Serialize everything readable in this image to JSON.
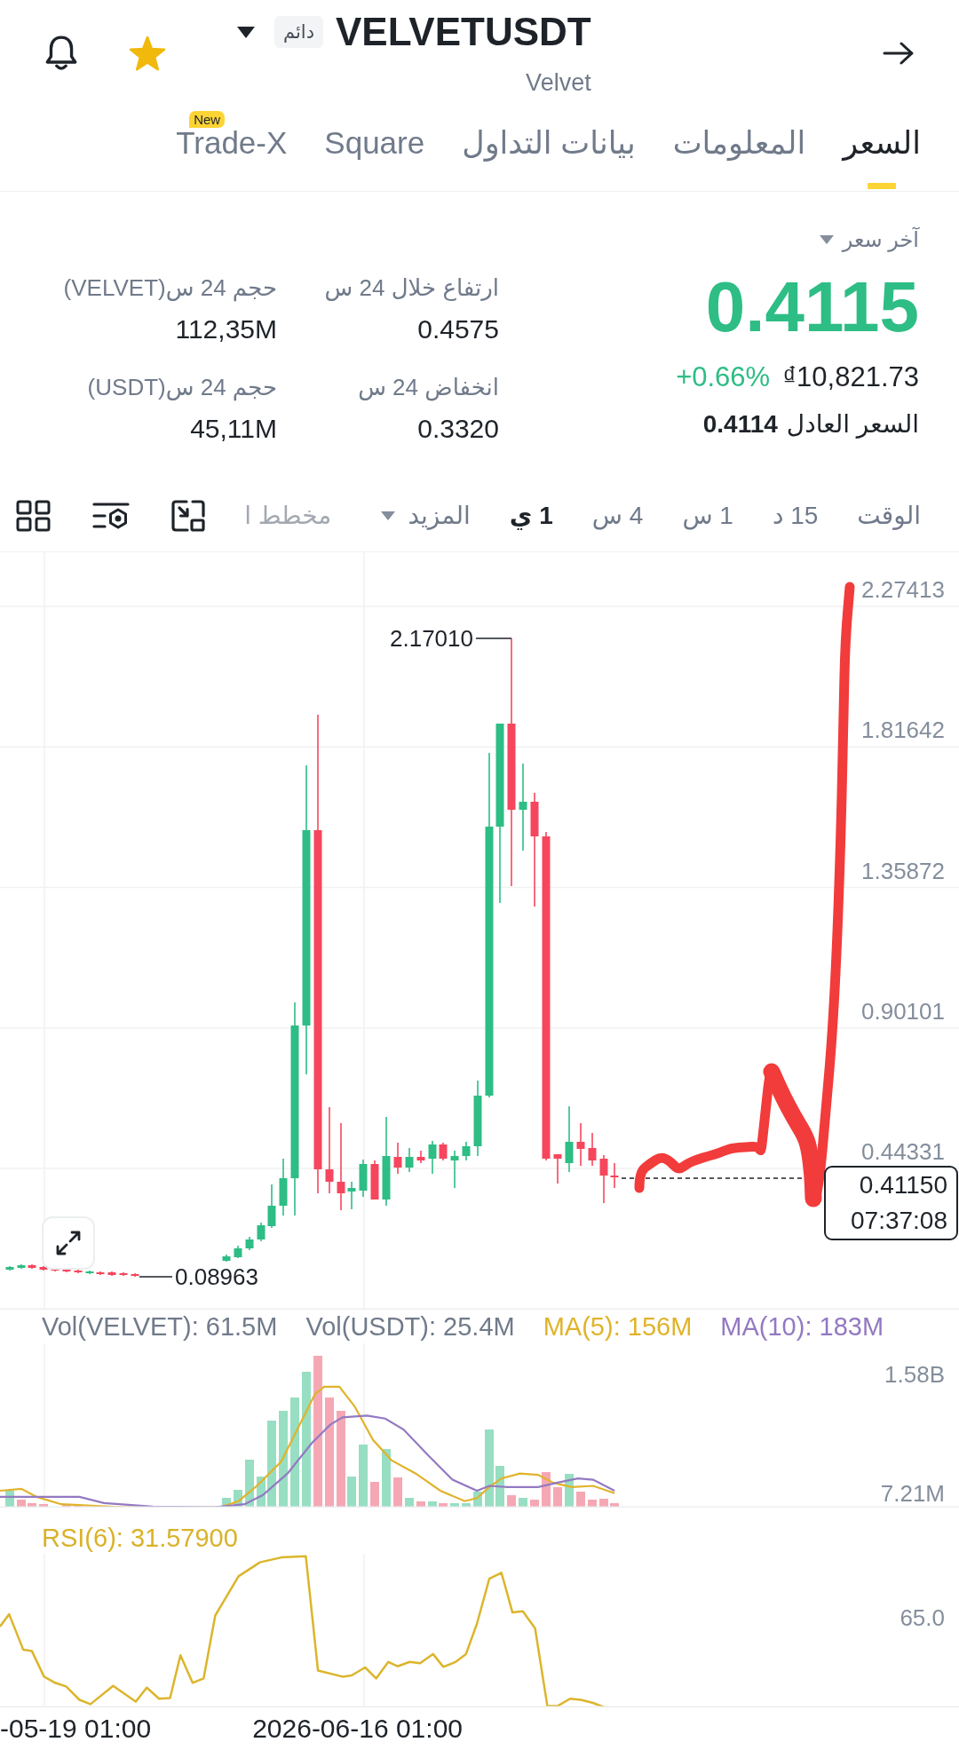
{
  "header": {
    "symbol": "VELVETUSDT",
    "contract_badge": "دائم",
    "name": "Velvet",
    "favorite": true
  },
  "tabs": [
    {
      "label": "السعر",
      "selected": true
    },
    {
      "label": "المعلومات",
      "selected": false
    },
    {
      "label": "بيانات التداول",
      "selected": false
    },
    {
      "label": "Square",
      "selected": false
    },
    {
      "label": "Trade-X",
      "selected": false,
      "badge": "New"
    }
  ],
  "price_panel": {
    "price_type": "آخر سعر",
    "last_price": "0.4115",
    "price_up": true,
    "change": "+0.66%",
    "fiat_value": "₫10,821.73",
    "fair_price_label": "السعر العادل",
    "fair_price": "0.4114"
  },
  "stats": [
    {
      "label": "ارتفاع خلال 24 س",
      "value": "0.4575"
    },
    {
      "label": "حجم 24 س(VELVET)",
      "value": "112,35M"
    },
    {
      "label": "انخفاض 24 س",
      "value": "0.3320"
    },
    {
      "label": "حجم 24 س(USDT)",
      "value": "45,11M"
    }
  ],
  "toolbar": {
    "label": "الوقت",
    "intervals": [
      {
        "label": "15 د",
        "selected": false
      },
      {
        "label": "1 س",
        "selected": false
      },
      {
        "label": "4 س",
        "selected": false
      },
      {
        "label": "1 ي",
        "selected": true
      }
    ],
    "more": "المزيد",
    "chart_mode": "مخطط ا"
  },
  "chart": {
    "price_axis": [
      "2.27413",
      "1.81642",
      "1.35872",
      "0.90101",
      "0.44331"
    ],
    "high_label": "2.17010",
    "low_label": "0.08963",
    "last_price": "0.41150",
    "countdown": "07:37:08"
  },
  "volume": {
    "legend": [
      {
        "text": "MA(10): 183M",
        "color": "#9379c2"
      },
      {
        "text": "MA(5): 156M",
        "color": "#e0b32a"
      },
      {
        "text": "Vol(USDT): 25.4M",
        "color": "#707a8a"
      },
      {
        "text": "Vol(VELVET): 61.5M",
        "color": "#707a8a"
      }
    ],
    "axis": [
      "1.58B",
      "7.21M"
    ]
  },
  "rsi": {
    "legend": "RSI(6): 31.57900",
    "axis": [
      "65.0"
    ]
  },
  "time_axis": [
    "2026-06-16 01:00",
    "-05-19 01:00"
  ]
}
